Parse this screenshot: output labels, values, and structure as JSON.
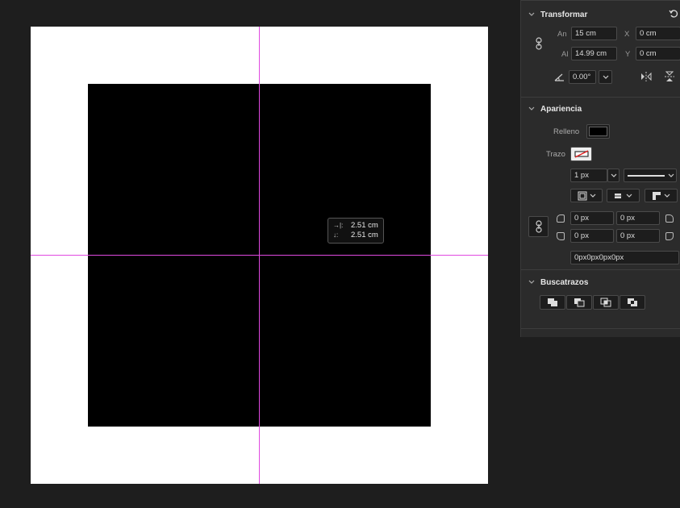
{
  "canvas": {
    "measure_tooltip": {
      "horizontal": "2.51 cm",
      "vertical": "2.51 cm"
    }
  },
  "colors": {
    "guide": "#e04ae0",
    "fill": "#000000",
    "artboard": "#ffffff"
  },
  "transform": {
    "title": "Transformar",
    "width_label": "An",
    "width_value": "15 cm",
    "height_label": "Al",
    "height_value": "14.99 cm",
    "x_label": "X",
    "x_value": "0 cm",
    "y_label": "Y",
    "y_value": "0 cm",
    "rotation_value": "0.00°"
  },
  "appearance": {
    "title": "Apariencia",
    "fill_label": "Relleno",
    "stroke_label": "Trazo",
    "stroke_width": "1 px",
    "corner_tl": "0 px",
    "corner_tr": "0 px",
    "corner_bl": "0 px",
    "corner_br": "0 px",
    "corner_css": "0px0px0px0px"
  },
  "pathfinder": {
    "title": "Buscatrazos"
  }
}
